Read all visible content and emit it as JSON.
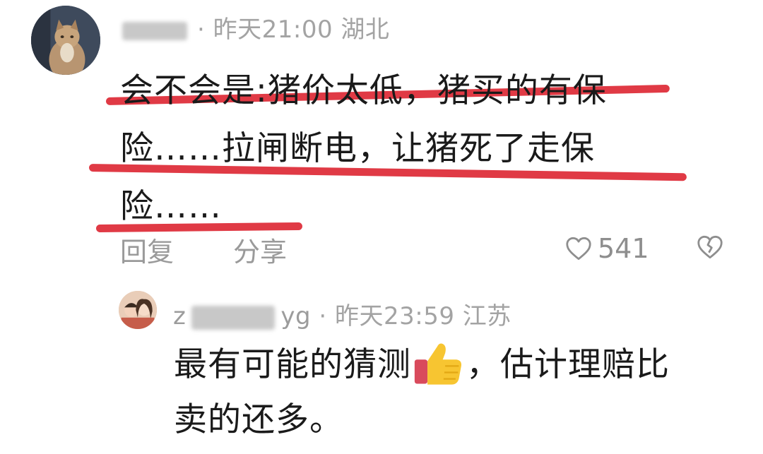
{
  "comment": {
    "meta": "· 昨天21:00 湖北",
    "lines": [
      "会不会是:猪价太低，猪买的有保",
      "险……拉闸断电，让猪死了走保",
      "险……"
    ],
    "reply_label": "回复",
    "share_label": "分享",
    "like_count": "541",
    "underline_color": "#e03a45"
  },
  "reply": {
    "nickname_start": "z",
    "nickname_end": "yg",
    "meta": "· 昨天23:59 江苏",
    "line1_before": "最有可能的猜测",
    "line1_after": "，估计理赔比",
    "line2": "卖的还多。",
    "emoji": "thumbs-up-icon"
  }
}
